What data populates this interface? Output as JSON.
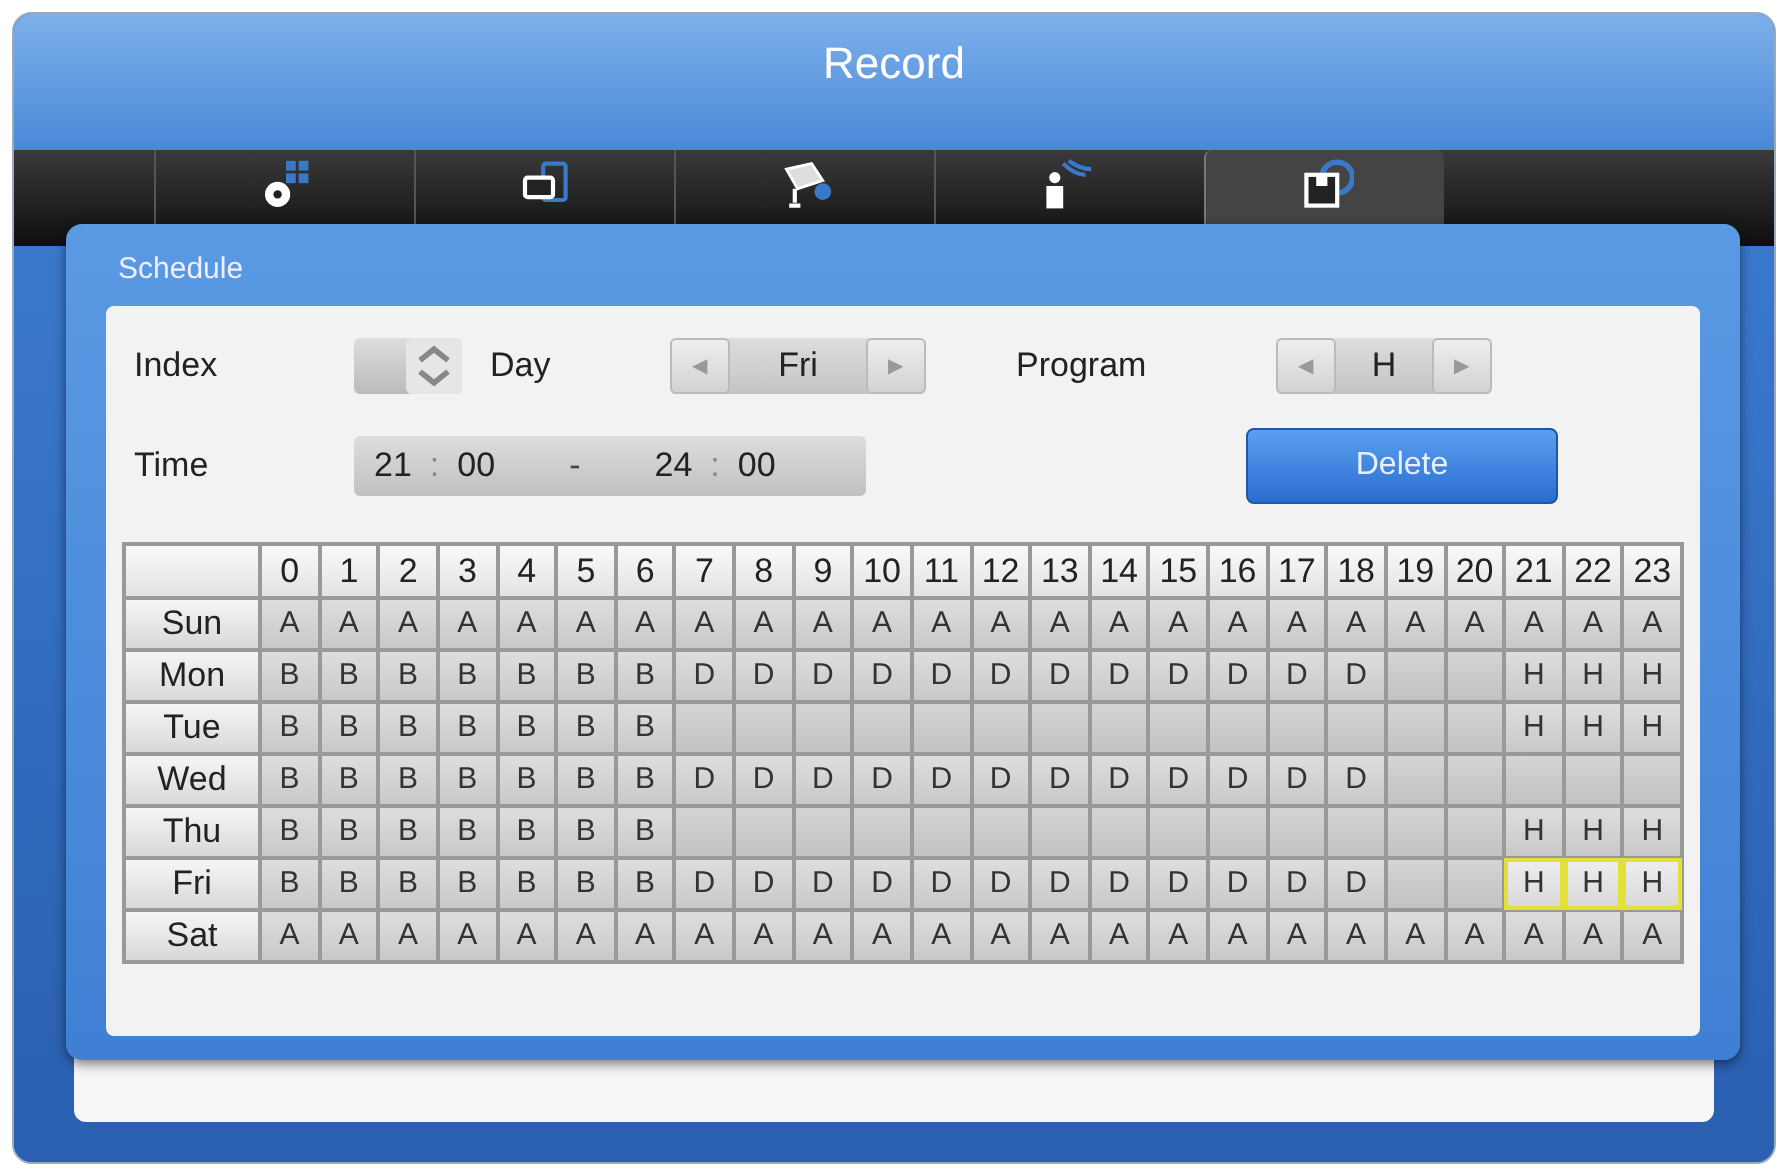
{
  "window": {
    "title": "Record"
  },
  "tabs": [
    {
      "kind": "settings",
      "selected": false
    },
    {
      "kind": "display",
      "selected": false
    },
    {
      "kind": "camera",
      "selected": false
    },
    {
      "kind": "sensor",
      "selected": false
    },
    {
      "kind": "storage",
      "selected": true
    }
  ],
  "dialog": {
    "title": "Schedule",
    "index": {
      "label": "Index"
    },
    "day": {
      "label": "Day",
      "value": "Fri",
      "prev": "◀",
      "next": "▶"
    },
    "program": {
      "label": "Program",
      "value": "H",
      "prev": "◀",
      "next": "▶"
    },
    "time": {
      "label": "Time",
      "start_hour": "21",
      "start_min": "00",
      "separator": "-",
      "end_hour": "24",
      "end_min": "00",
      "colon": ":"
    },
    "delete_button": "Delete",
    "grid": {
      "hours": [
        "0",
        "1",
        "2",
        "3",
        "4",
        "5",
        "6",
        "7",
        "8",
        "9",
        "10",
        "11",
        "12",
        "13",
        "14",
        "15",
        "16",
        "17",
        "18",
        "19",
        "20",
        "21",
        "22",
        "23"
      ],
      "rows": [
        {
          "day": "Sun",
          "cells": [
            {
              "program": "A",
              "selected": false
            },
            {
              "program": "A",
              "selected": false
            },
            {
              "program": "A",
              "selected": false
            },
            {
              "program": "A",
              "selected": false
            },
            {
              "program": "A",
              "selected": false
            },
            {
              "program": "A",
              "selected": false
            },
            {
              "program": "A",
              "selected": false
            },
            {
              "program": "A",
              "selected": false
            },
            {
              "program": "A",
              "selected": false
            },
            {
              "program": "A",
              "selected": false
            },
            {
              "program": "A",
              "selected": false
            },
            {
              "program": "A",
              "selected": false
            },
            {
              "program": "A",
              "selected": false
            },
            {
              "program": "A",
              "selected": false
            },
            {
              "program": "A",
              "selected": false
            },
            {
              "program": "A",
              "selected": false
            },
            {
              "program": "A",
              "selected": false
            },
            {
              "program": "A",
              "selected": false
            },
            {
              "program": "A",
              "selected": false
            },
            {
              "program": "A",
              "selected": false
            },
            {
              "program": "A",
              "selected": false
            },
            {
              "program": "A",
              "selected": false
            },
            {
              "program": "A",
              "selected": false
            },
            {
              "program": "A",
              "selected": false
            }
          ]
        },
        {
          "day": "Mon",
          "cells": [
            {
              "program": "B",
              "selected": false
            },
            {
              "program": "B",
              "selected": false
            },
            {
              "program": "B",
              "selected": false
            },
            {
              "program": "B",
              "selected": false
            },
            {
              "program": "B",
              "selected": false
            },
            {
              "program": "B",
              "selected": false
            },
            {
              "program": "B",
              "selected": false
            },
            {
              "program": "D",
              "selected": false
            },
            {
              "program": "D",
              "selected": false
            },
            {
              "program": "D",
              "selected": false
            },
            {
              "program": "D",
              "selected": false
            },
            {
              "program": "D",
              "selected": false
            },
            {
              "program": "D",
              "selected": false
            },
            {
              "program": "D",
              "selected": false
            },
            {
              "program": "D",
              "selected": false
            },
            {
              "program": "D",
              "selected": false
            },
            {
              "program": "D",
              "selected": false
            },
            {
              "program": "D",
              "selected": false
            },
            {
              "program": "D",
              "selected": false
            },
            {
              "selected": false
            },
            {
              "selected": false
            },
            {
              "program": "H",
              "selected": false
            },
            {
              "program": "H",
              "selected": false
            },
            {
              "program": "H",
              "selected": false
            }
          ]
        },
        {
          "day": "Tue",
          "cells": [
            {
              "program": "B",
              "selected": false
            },
            {
              "program": "B",
              "selected": false
            },
            {
              "program": "B",
              "selected": false
            },
            {
              "program": "B",
              "selected": false
            },
            {
              "program": "B",
              "selected": false
            },
            {
              "program": "B",
              "selected": false
            },
            {
              "program": "B",
              "selected": false
            },
            {
              "selected": false
            },
            {
              "selected": false
            },
            {
              "selected": false
            },
            {
              "selected": false
            },
            {
              "selected": false
            },
            {
              "selected": false
            },
            {
              "selected": false
            },
            {
              "selected": false
            },
            {
              "selected": false
            },
            {
              "selected": false
            },
            {
              "selected": false
            },
            {
              "selected": false
            },
            {
              "selected": false
            },
            {
              "selected": false
            },
            {
              "program": "H",
              "selected": false
            },
            {
              "program": "H",
              "selected": false
            },
            {
              "program": "H",
              "selected": false
            }
          ]
        },
        {
          "day": "Wed",
          "cells": [
            {
              "program": "B",
              "selected": false
            },
            {
              "program": "B",
              "selected": false
            },
            {
              "program": "B",
              "selected": false
            },
            {
              "program": "B",
              "selected": false
            },
            {
              "program": "B",
              "selected": false
            },
            {
              "program": "B",
              "selected": false
            },
            {
              "program": "B",
              "selected": false
            },
            {
              "program": "D",
              "selected": false
            },
            {
              "program": "D",
              "selected": false
            },
            {
              "program": "D",
              "selected": false
            },
            {
              "program": "D",
              "selected": false
            },
            {
              "program": "D",
              "selected": false
            },
            {
              "program": "D",
              "selected": false
            },
            {
              "program": "D",
              "selected": false
            },
            {
              "program": "D",
              "selected": false
            },
            {
              "program": "D",
              "selected": false
            },
            {
              "program": "D",
              "selected": false
            },
            {
              "program": "D",
              "selected": false
            },
            {
              "program": "D",
              "selected": false
            },
            {
              "selected": false
            },
            {
              "selected": false
            },
            {
              "selected": false
            },
            {
              "selected": false
            },
            {
              "selected": false
            }
          ]
        },
        {
          "day": "Thu",
          "cells": [
            {
              "program": "B",
              "selected": false
            },
            {
              "program": "B",
              "selected": false
            },
            {
              "program": "B",
              "selected": false
            },
            {
              "program": "B",
              "selected": false
            },
            {
              "program": "B",
              "selected": false
            },
            {
              "program": "B",
              "selected": false
            },
            {
              "program": "B",
              "selected": false
            },
            {
              "selected": false
            },
            {
              "selected": false
            },
            {
              "selected": false
            },
            {
              "selected": false
            },
            {
              "selected": false
            },
            {
              "selected": false
            },
            {
              "selected": false
            },
            {
              "selected": false
            },
            {
              "selected": false
            },
            {
              "selected": false
            },
            {
              "selected": false
            },
            {
              "selected": false
            },
            {
              "selected": false
            },
            {
              "selected": false
            },
            {
              "program": "H",
              "selected": false
            },
            {
              "program": "H",
              "selected": false
            },
            {
              "program": "H",
              "selected": false
            }
          ]
        },
        {
          "day": "Fri",
          "cells": [
            {
              "program": "B",
              "selected": false
            },
            {
              "program": "B",
              "selected": false
            },
            {
              "program": "B",
              "selected": false
            },
            {
              "program": "B",
              "selected": false
            },
            {
              "program": "B",
              "selected": false
            },
            {
              "program": "B",
              "selected": false
            },
            {
              "program": "B",
              "selected": false
            },
            {
              "program": "D",
              "selected": false
            },
            {
              "program": "D",
              "selected": false
            },
            {
              "program": "D",
              "selected": false
            },
            {
              "program": "D",
              "selected": false
            },
            {
              "program": "D",
              "selected": false
            },
            {
              "program": "D",
              "selected": false
            },
            {
              "program": "D",
              "selected": false
            },
            {
              "program": "D",
              "selected": false
            },
            {
              "program": "D",
              "selected": false
            },
            {
              "program": "D",
              "selected": false
            },
            {
              "program": "D",
              "selected": false
            },
            {
              "program": "D",
              "selected": false
            },
            {
              "selected": false
            },
            {
              "selected": false
            },
            {
              "program": "H",
              "selected": true
            },
            {
              "program": "H",
              "selected": true
            },
            {
              "program": "H",
              "selected": true
            }
          ]
        },
        {
          "day": "Sat",
          "cells": [
            {
              "program": "A",
              "selected": false
            },
            {
              "program": "A",
              "selected": false
            },
            {
              "program": "A",
              "selected": false
            },
            {
              "program": "A",
              "selected": false
            },
            {
              "program": "A",
              "selected": false
            },
            {
              "program": "A",
              "selected": false
            },
            {
              "program": "A",
              "selected": false
            },
            {
              "program": "A",
              "selected": false
            },
            {
              "program": "A",
              "selected": false
            },
            {
              "program": "A",
              "selected": false
            },
            {
              "program": "A",
              "selected": false
            },
            {
              "program": "A",
              "selected": false
            },
            {
              "program": "A",
              "selected": false
            },
            {
              "program": "A",
              "selected": false
            },
            {
              "program": "A",
              "selected": false
            },
            {
              "program": "A",
              "selected": false
            },
            {
              "program": "A",
              "selected": false
            },
            {
              "program": "A",
              "selected": false
            },
            {
              "program": "A",
              "selected": false
            },
            {
              "program": "A",
              "selected": false
            },
            {
              "program": "A",
              "selected": false
            },
            {
              "program": "A",
              "selected": false
            },
            {
              "program": "A",
              "selected": false
            },
            {
              "program": "A",
              "selected": false
            }
          ]
        }
      ]
    }
  }
}
